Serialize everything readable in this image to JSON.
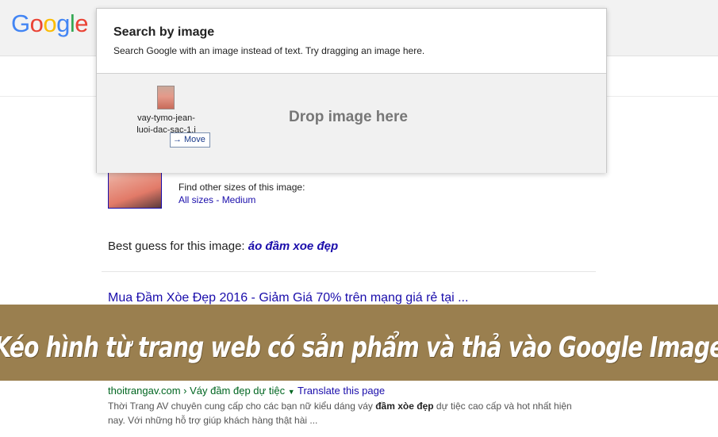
{
  "logo": {
    "letters": [
      "G",
      "o",
      "o",
      "g",
      "l",
      "e"
    ],
    "colors": [
      "#4285f4",
      "#ea4335",
      "#fbbc05",
      "#4285f4",
      "#34a853",
      "#ea4335"
    ]
  },
  "dialog": {
    "title": "Search by image",
    "subtitle": "Search Google with an image instead of text. Try dragging an image here.",
    "drop_label": "Drop image here",
    "dragged_file": "vay-tymo-jean-luoi-dac-sac-1.j",
    "move_label": "Move"
  },
  "results": {
    "find_sizes": "Find other sizes of this image:",
    "all_sizes": "All sizes",
    "size_separator": " - ",
    "medium": "Medium",
    "best_guess_prefix": "Best guess for this image: ",
    "best_guess_link": "áo đầm xoe đẹp",
    "first_result": {
      "title": "Mua Đầm Xòe Đẹp 2016 - Giảm Giá 70% trên mạng giá rẻ tại ...",
      "url": "thoitrangav.com › Váy đầm đẹp dự tiệc",
      "translate": "Translate this page",
      "snippet_1": "Thời Trang AV chuyên cung cấp cho các bạn nữ kiểu dáng váy ",
      "snippet_bold": "đầm xòe đẹp",
      "snippet_2": " dự tiệc cao cấp và hot nhất hiện nay. Với những hỗ trợ giúp khách hàng thật hài ..."
    }
  },
  "banner": {
    "text": "Kéo hình từ trang web có sản phẩm và thả vào Google Image",
    "background": "#9a7f4f"
  }
}
